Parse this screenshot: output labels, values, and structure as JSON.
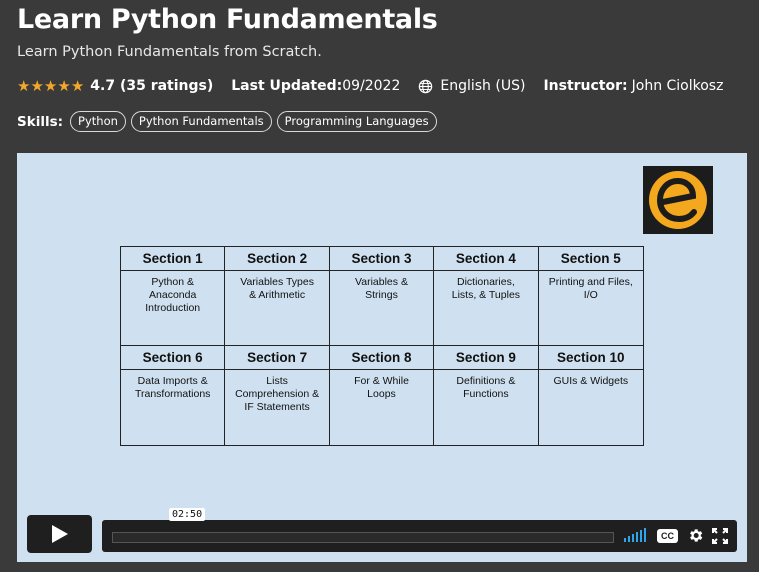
{
  "course": {
    "title": "Learn Python Fundamentals",
    "subtitle": "Learn Python Fundamentals from Scratch.",
    "rating_text": "4.7 (35 ratings)",
    "rating_value": 4.7,
    "updated_label": "Last Updated:",
    "updated_value": "09/2022",
    "language_icon": "globe-icon",
    "language": "English (US)",
    "instructor_label": "Instructor:",
    "instructor": "John Ciolkosz",
    "colors": {
      "star": "#f3a72b",
      "background": "#3a3a3a",
      "video_bg": "#cfe1f1",
      "logo_orange": "#f4a81d"
    }
  },
  "skills": {
    "label": "Skills:",
    "items": [
      "Python",
      "Python Fundamentals",
      "Programming Languages"
    ]
  },
  "video": {
    "sections": [
      {
        "heading": "Section 1",
        "body": "Python &\nAnaconda\nIntroduction"
      },
      {
        "heading": "Section 2",
        "body": "Variables Types\n& Arithmetic"
      },
      {
        "heading": "Section 3",
        "body": "Variables &\nStrings"
      },
      {
        "heading": "Section 4",
        "body": "Dictionaries,\nLists, & Tuples"
      },
      {
        "heading": "Section 5",
        "body": "Printing and Files,\nI/O"
      },
      {
        "heading": "Section 6",
        "body": "Data Imports &\nTransformations"
      },
      {
        "heading": "Section 7",
        "body": "Lists\nComprehension &\nIF Statements"
      },
      {
        "heading": "Section 8",
        "body": "For & While\nLoops"
      },
      {
        "heading": "Section 9",
        "body": "Definitions &\nFunctions"
      },
      {
        "heading": "Section 10",
        "body": "GUIs & Widgets"
      }
    ],
    "player": {
      "time": "02:50",
      "cc_label": "CC",
      "icons": [
        "play-icon",
        "volume-icon",
        "cc-icon",
        "gear-icon",
        "fullscreen-icon"
      ]
    }
  }
}
